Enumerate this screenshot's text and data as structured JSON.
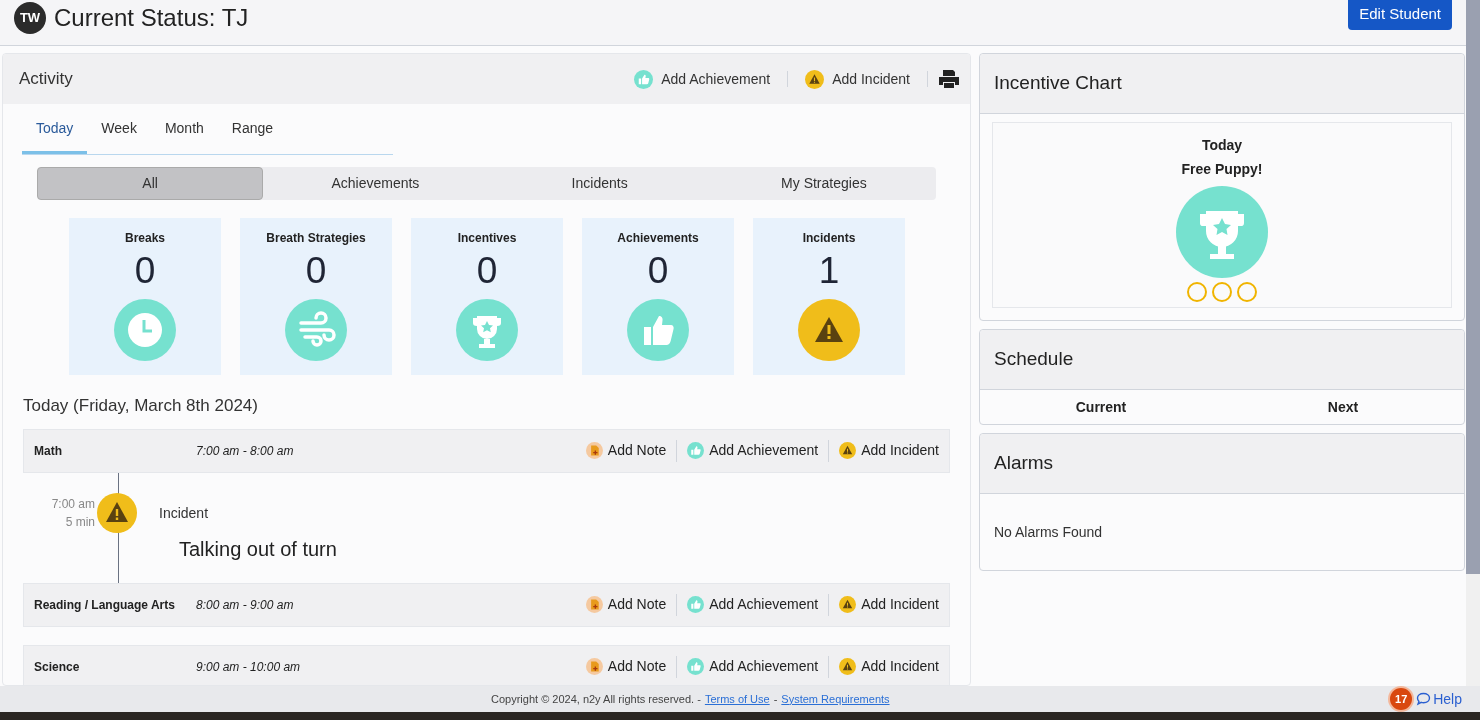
{
  "header": {
    "avatar": "TW",
    "title": "Current Status: TJ",
    "edit_button": "Edit Student"
  },
  "activity": {
    "title": "Activity",
    "actions": [
      {
        "kind": "achievement",
        "label": "Add Achievement"
      },
      {
        "kind": "incident",
        "label": "Add Incident"
      }
    ],
    "tabs": [
      {
        "label": "Today",
        "selected": true
      },
      {
        "label": "Week",
        "selected": false
      },
      {
        "label": "Month",
        "selected": false
      },
      {
        "label": "Range",
        "selected": false
      }
    ],
    "filters": [
      {
        "label": "All",
        "selected": true
      },
      {
        "label": "Achievements",
        "selected": false
      },
      {
        "label": "Incidents",
        "selected": false
      },
      {
        "label": "My Strategies",
        "selected": false
      }
    ],
    "stats": [
      {
        "kind": "breaks",
        "label": "Breaks",
        "count": "0"
      },
      {
        "kind": "breath",
        "label": "Breath Strategies",
        "count": "0"
      },
      {
        "kind": "incentives",
        "label": "Incentives",
        "count": "0"
      },
      {
        "kind": "achievements",
        "label": "Achievements",
        "count": "0"
      },
      {
        "kind": "incidents",
        "label": "Incidents",
        "count": "1"
      }
    ],
    "day_title": "Today (Friday, March 8th 2024)",
    "periods": [
      {
        "name": "Math",
        "time": "7:00 am - 8:00 am",
        "actions": [
          "Add Note",
          "Add Achievement",
          "Add Incident"
        ],
        "events": [
          {
            "kind": "incident",
            "time": "7:00 am",
            "duration": "5 min",
            "type": "Incident",
            "description": "Talking out of turn"
          }
        ]
      },
      {
        "name": "Reading / Language Arts",
        "time": "8:00 am - 9:00 am",
        "actions": [
          "Add Note",
          "Add Achievement",
          "Add Incident"
        ]
      },
      {
        "name": "Science",
        "time": "9:00 am - 10:00 am",
        "actions": [
          "Add Note",
          "Add Achievement",
          "Add Incident"
        ]
      }
    ]
  },
  "incentive_chart": {
    "title": "Incentive Chart",
    "day": "Today",
    "reward": "Free Puppy!",
    "tokens": [
      {
        "filled": false
      },
      {
        "filled": false
      },
      {
        "filled": false
      }
    ]
  },
  "schedule": {
    "title": "Schedule",
    "columns": [
      "Current",
      "Next"
    ]
  },
  "alarms": {
    "title": "Alarms",
    "message": "No Alarms Found"
  },
  "footer": {
    "copyright": "Copyright © 2024, n2y All rights reserved. -",
    "links": [
      {
        "label": "Terms of Use"
      },
      {
        "label": "System Requirements"
      }
    ],
    "separator": "-",
    "help_count": "17",
    "help": "Help"
  }
}
